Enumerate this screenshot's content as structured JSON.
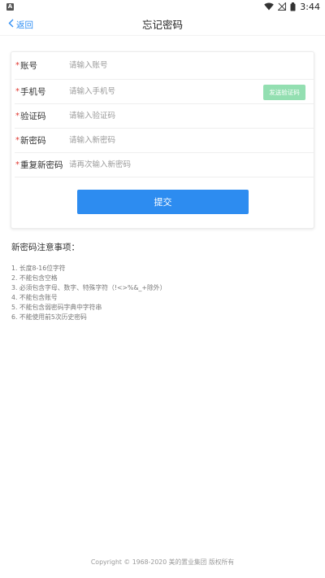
{
  "status_bar": {
    "app_badge": "A",
    "time": "3:44"
  },
  "nav": {
    "back_label": "返回",
    "title": "忘记密码"
  },
  "form": {
    "required_mark": "*",
    "fields": [
      {
        "label": "账号",
        "placeholder": "请输入账号"
      },
      {
        "label": "手机号",
        "placeholder": "请输入手机号"
      },
      {
        "label": "验证码",
        "placeholder": "请输入验证码"
      },
      {
        "label": "新密码",
        "placeholder": "请输入新密码"
      },
      {
        "label": "重复新密码",
        "placeholder": "请再次输入新密码"
      }
    ],
    "send_code_label": "发送验证码",
    "submit_label": "提交"
  },
  "notes": {
    "title": "新密码注意事项：",
    "items": [
      "1. 长度8-16位字符",
      "2. 不能包含空格",
      "3. 必须包含字母、数字、特殊字符（!<>%&_+除外）",
      "4. 不能包含账号",
      "5. 不能包含弱密码字典中字符串",
      "6. 不能使用前5次历史密码"
    ]
  },
  "footer": {
    "copyright": "Copyright © 1968-2020 美的置业集团 版权所有"
  },
  "colors": {
    "primary": "#2d8cf0",
    "link": "#2f8ef3",
    "send_code_bg": "#93dfb1",
    "required": "#e0372f"
  }
}
